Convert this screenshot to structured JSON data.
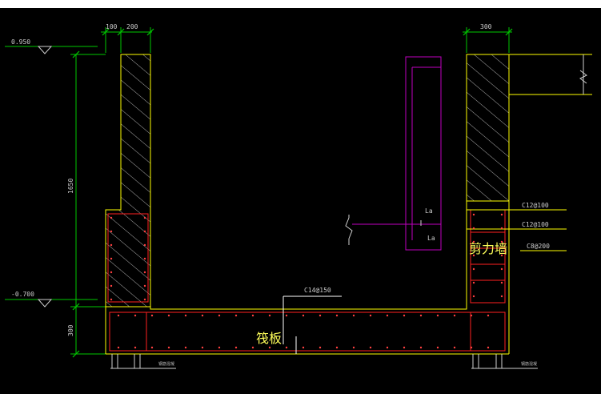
{
  "drawing": {
    "level_top": "0.950",
    "level_bottom": "-0.700",
    "dim_left_wall_100": "100",
    "dim_left_wall_200": "200",
    "dim_right_wall_300": "300",
    "dim_height_1650": "1650",
    "dim_slab_300": "300",
    "rebar_top_1": "C12@100",
    "rebar_top_2": "C12@100",
    "rebar_dist": "C8@200",
    "rebar_slab": "C14@150",
    "anchor_label_1": "La",
    "anchor_label_2": "La",
    "label_shear_wall": "剪力墙",
    "label_raft": "筏板",
    "pile_note_left": "钢筋混凝",
    "pile_note_right": "钢筋混凝"
  },
  "colors": {
    "background": "#000000",
    "wall_outline": "#ffff00",
    "rebar": "#ff2020",
    "dimension": "#00c800",
    "anchor": "#c000c0",
    "leader": "#ffffff"
  }
}
